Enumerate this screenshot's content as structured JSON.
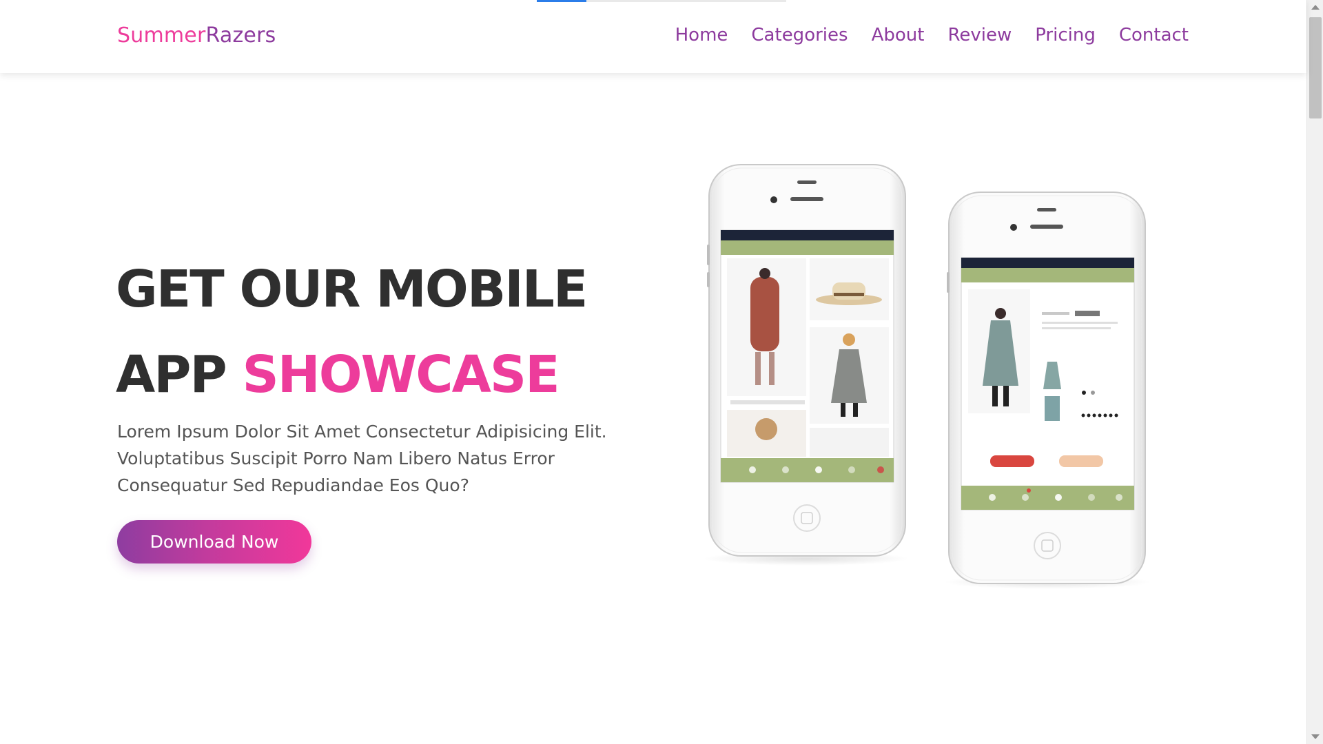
{
  "header": {
    "logo_part1": "Summer",
    "logo_part2": "Razers",
    "nav": [
      {
        "label": "Home"
      },
      {
        "label": "Categories"
      },
      {
        "label": "About"
      },
      {
        "label": "Review"
      },
      {
        "label": "Pricing"
      },
      {
        "label": "Contact"
      }
    ]
  },
  "hero": {
    "title_line1": "GET OUR MOBILE",
    "title_line2_plain": "APP ",
    "title_line2_accent": "SHOWCASE",
    "description": "Lorem Ipsum Dolor Sit Amet Consectetur Adipisicing Elit. Voluptatibus Suscipit Porro Nam Libero Natus Error Consequatur Sed Repudiandae Eos Quo?",
    "download_label": "Download Now"
  },
  "colors": {
    "brand_pink": "#ed3c9b",
    "brand_purple": "#8d3b9e",
    "heading_text": "#2f2f2f",
    "body_text": "#555555",
    "loading_accent": "#2b7de9"
  },
  "icons": [
    "phone-mockup-illustration",
    "scroll-up-arrow-icon",
    "scroll-down-arrow-icon"
  ]
}
